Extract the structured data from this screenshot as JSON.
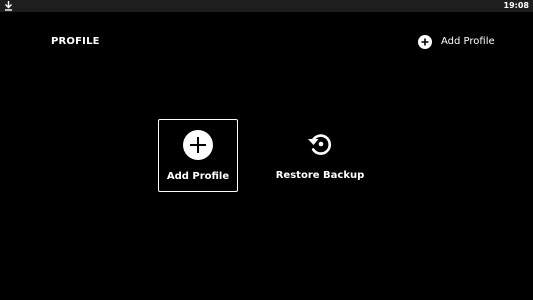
{
  "status_bar": {
    "time": "19:08",
    "left_icon": "download-icon"
  },
  "header": {
    "title": "PROFILE",
    "add_button": {
      "label": "Add Profile",
      "icon": "plus-circle-icon"
    }
  },
  "options": [
    {
      "label": "Add Profile",
      "icon": "plus-circle-icon",
      "selected": true
    },
    {
      "label": "Restore Backup",
      "icon": "restore-icon",
      "selected": false
    }
  ],
  "colors": {
    "background": "#000000",
    "foreground": "#ffffff",
    "status_bar": "#1e1e1e"
  }
}
